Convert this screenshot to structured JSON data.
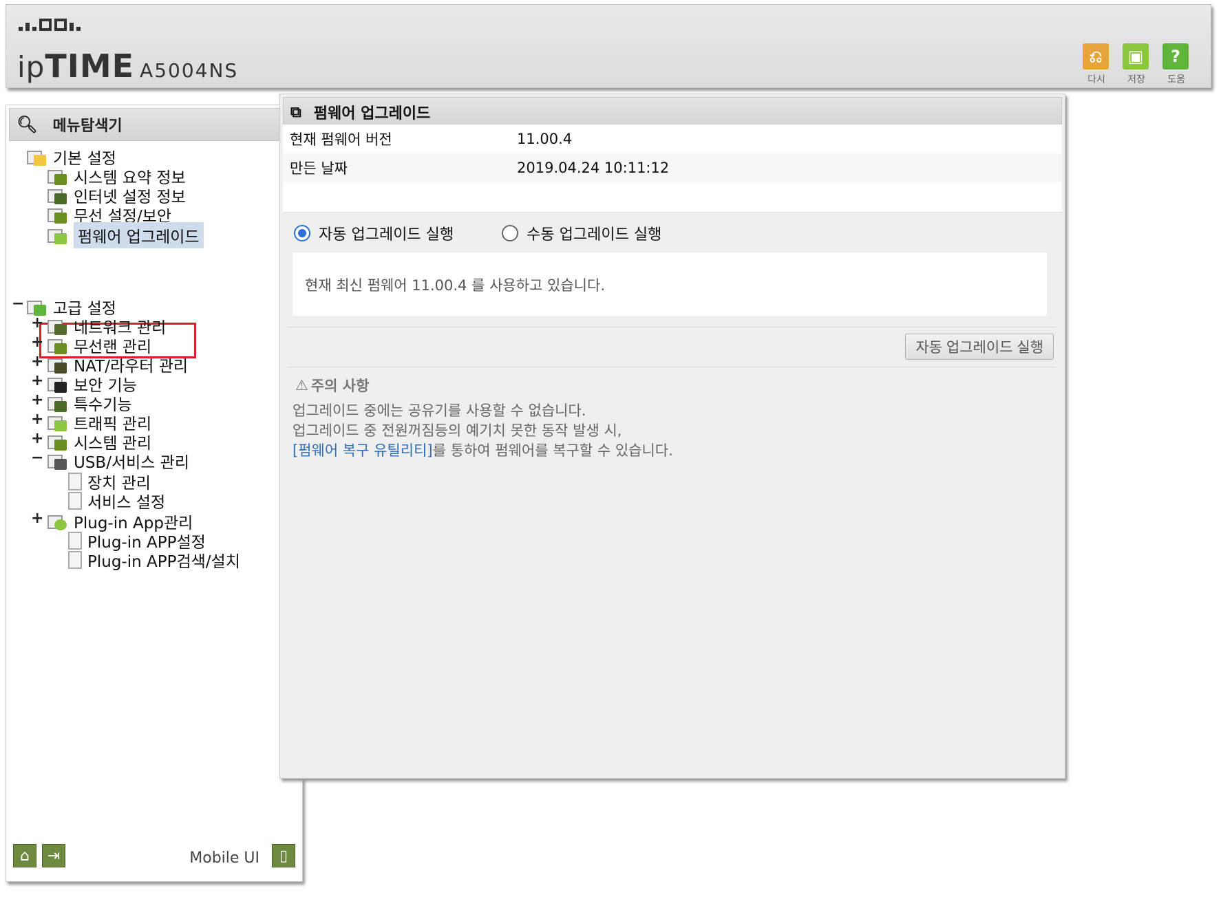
{
  "header": {
    "brand_ip": "ip",
    "brand_time": "TIME",
    "model": "A5004NS",
    "tools": [
      {
        "label": "다시",
        "icon": "undo-icon",
        "color": "#e8a33a"
      },
      {
        "label": "저장",
        "icon": "save-icon",
        "color": "#8cc63f"
      },
      {
        "label": "도움",
        "icon": "help-icon",
        "color": "#5fb53a"
      }
    ]
  },
  "sidebar": {
    "title": "메뉴탐색기",
    "basic": {
      "label": "기본 설정",
      "items": [
        "시스템 요약 정보",
        "인터넷 설정 정보",
        "무선 설정/보안",
        "펌웨어 업그레이드"
      ]
    },
    "advanced": {
      "label": "고급 설정",
      "toggle": "−",
      "items": [
        {
          "label": "네트워크 관리",
          "toggle": "+"
        },
        {
          "label": "무선랜 관리",
          "toggle": "+"
        },
        {
          "label": "NAT/라우터 관리",
          "toggle": "+"
        },
        {
          "label": "보안 기능",
          "toggle": "+"
        },
        {
          "label": "특수기능",
          "toggle": "+"
        },
        {
          "label": "트래픽 관리",
          "toggle": "+"
        },
        {
          "label": "시스템 관리",
          "toggle": "+"
        },
        {
          "label": "USB/서비스 관리",
          "toggle": "−"
        },
        {
          "label": "장치 관리",
          "toggle": ""
        },
        {
          "label": "서비스 설정",
          "toggle": ""
        },
        {
          "label": "Plug-in App관리",
          "toggle": "+"
        },
        {
          "label": "Plug-in APP설정",
          "toggle": ""
        },
        {
          "label": "Plug-in APP검색/설치",
          "toggle": ""
        }
      ]
    },
    "footer": {
      "mobile_label": "Mobile UI"
    }
  },
  "main": {
    "title": "펌웨어 업그레이드",
    "info": [
      {
        "key": "현재 펌웨어 버전",
        "value": "11.00.4"
      },
      {
        "key": "만든 날짜",
        "value": "2019.04.24 10:11:12"
      }
    ],
    "radio_auto": "자동 업그레이드 실행",
    "radio_manual": "수동 업그레이드 실행",
    "selected_mode": "auto",
    "message": "현재 최신 펌웨어 11.00.4 를 사용하고 있습니다.",
    "run_button": "자동 업그레이드 실행",
    "notice_title": "주의 사항",
    "notice_line1": "업그레이드 중에는 공유기를 사용할 수 없습니다.",
    "notice_line2": "업그레이드 중 전원꺼짐등의 예기치 못한 동작 발생 시,",
    "notice_link": "[펌웨어 복구 유틸리티]",
    "notice_line3": "를 통하여 펌웨어를 복구할 수 있습니다."
  }
}
